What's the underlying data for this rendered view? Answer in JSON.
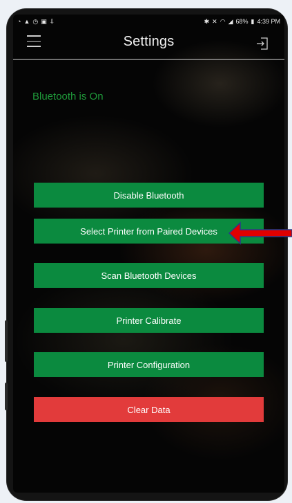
{
  "status_bar": {
    "left_icons": [
      "signal-icon",
      "warning-icon",
      "alarm-icon",
      "image-icon",
      "download-icon"
    ],
    "battery": "68%",
    "time": "4:39 PM"
  },
  "header": {
    "title": "Settings"
  },
  "bluetooth_status": "Bluetooth is On",
  "buttons": {
    "disable_bluetooth": "Disable Bluetooth",
    "select_printer": "Select Printer from Paired Devices",
    "scan_devices": "Scan Bluetooth Devices",
    "printer_calibrate": "Printer Calibrate",
    "printer_configuration": "Printer Configuration",
    "clear_data": "Clear Data"
  },
  "colors": {
    "button_green": "#0b8a3f",
    "button_red": "#e23b3b",
    "status_green": "#1f9a3a",
    "annotation_arrow": "#e00000"
  }
}
